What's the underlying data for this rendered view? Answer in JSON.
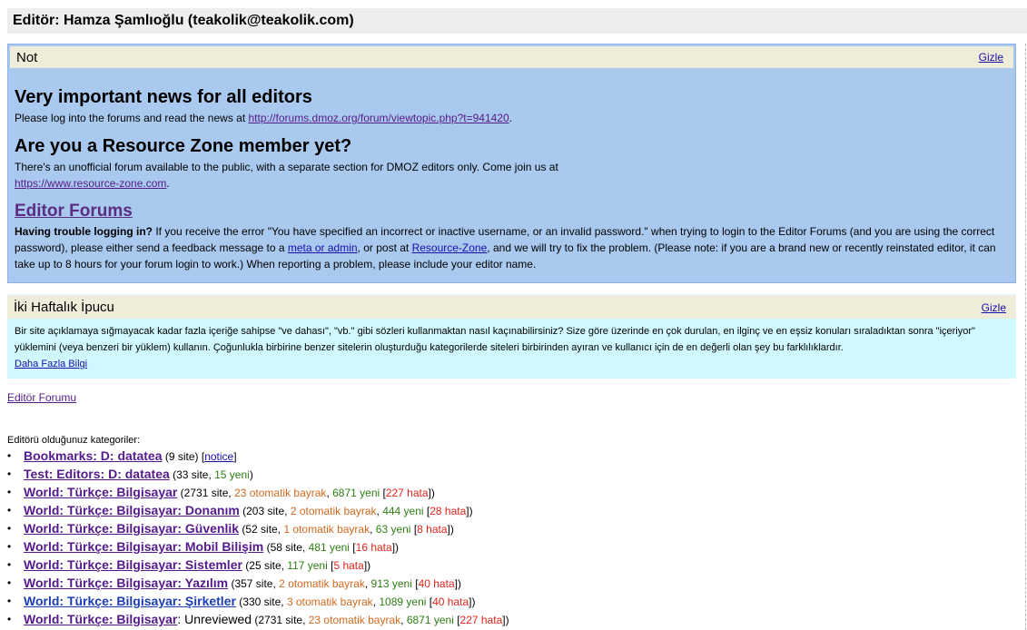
{
  "header": {
    "title": "Editör: Hamza Şamlıoğlu (teakolik@teakolik.com)"
  },
  "note_panel": {
    "label": "Not",
    "hide_label": "Gizle",
    "news_heading": "Very important news for all editors",
    "news_text": "Please log into the forums and read the news at ",
    "news_link": "http://forums.dmoz.org/forum/viewtopic.php?t=941420",
    "news_end": ".",
    "rz_heading": "Are you a Resource Zone member yet?",
    "rz_text": "There's an unofficial forum available to the public, with a separate section for DMOZ editors only. Come join us at",
    "rz_link": "https://www.resource-zone.com",
    "rz_end": ".",
    "forums_heading": "Editor Forums",
    "trouble_bold": "Having trouble logging in?",
    "trouble_text1": " If you receive the error \"You have specified an incorrect or inactive username, or an invalid password.\" when trying to login to the Editor Forums (and you are using the correct password), please either send a feedback message to a ",
    "meta_link": "meta or admin",
    "trouble_text2": ", or post at ",
    "rz_post_link": "Resource-Zone",
    "trouble_text3": ", and we will try to fix the problem. (Please note: if you are a brand new or recently reinstated editor, it can take up to 8 hours for your forum login to work.) When reporting a problem, please include your editor name."
  },
  "tip_panel": {
    "label": "İki Haftalık İpucu",
    "hide_label": "Gizle",
    "text": "Bir site açıklamaya sığmayacak kadar fazla içeriğe sahipse \"ve dahası\", \"vb.\" gibi sözleri kullanmaktan nasıl kaçınabilirsiniz? Size göre üzerinde en çok durulan, en ilginç ve en eşsiz konuları sıraladıktan sonra \"içeriyor\" yüklemini (veya benzeri bir yüklem) kullanın. Çoğunlukla birbirine benzer sitelerin oluşturduğu kategorilerde siteleri birbirinden ayıran ve kullanıcı için de en değerli olan şey bu farklılıklardır.",
    "more_link": "Daha Fazla Bilgi"
  },
  "forum_link": "Editör Forumu",
  "categories_heading": "Editörü olduğunuz kategoriler:",
  "categories": [
    {
      "name": "Bookmarks: D: datatea",
      "pre": " (9 site) [",
      "notice": "notice",
      "post": "]"
    },
    {
      "name": "Test: Editors: D: datatea",
      "pre": " (33 site, ",
      "new": "15 yeni",
      "post": ")"
    },
    {
      "name": "World: Türkçe: Bilgisayar",
      "pre": " (2731 site, ",
      "flags": "23 otomatik bayrak",
      "sep1": ", ",
      "new": "6871 yeni",
      "sep2": " [",
      "errors": "227 hata",
      "post": "])"
    },
    {
      "name": "World: Türkçe: Bilgisayar: Donanım",
      "pre": " (203 site, ",
      "flags": "2 otomatik bayrak",
      "sep1": ", ",
      "new": "444 yeni",
      "sep2": " [",
      "errors": "28 hata",
      "post": "])"
    },
    {
      "name": "World: Türkçe: Bilgisayar: Güvenlik",
      "pre": " (52 site, ",
      "flags": "1 otomatik bayrak",
      "sep1": ", ",
      "new": "63 yeni",
      "sep2": " [",
      "errors": "8 hata",
      "post": "])"
    },
    {
      "name": "World: Türkçe: Bilgisayar: Mobil Bilişim",
      "pre": " (58 site, ",
      "new": "481 yeni",
      "sep2": " [",
      "errors": "16 hata",
      "post": "])"
    },
    {
      "name": "World: Türkçe: Bilgisayar: Sistemler",
      "pre": " (25 site, ",
      "new": "117 yeni",
      "sep2": " [",
      "errors": "5 hata",
      "post": "])"
    },
    {
      "name": "World: Türkçe: Bilgisayar: Yazılım",
      "pre": " (357 site, ",
      "flags": "2 otomatik bayrak",
      "sep1": ", ",
      "new": "913 yeni",
      "sep2": " [",
      "errors": "40 hata",
      "post": "])"
    },
    {
      "name": "World: Türkçe: Bilgisayar: Şirketler",
      "pre": " (330 site, ",
      "flags": "3 otomatik bayrak",
      "sep1": ", ",
      "new": "1089 yeni",
      "sep2": " [",
      "errors": "40 hata",
      "post": "])"
    },
    {
      "name": "World: Türkçe: Bilgisayar",
      "suffix": ": Unreviewed",
      "pre": " (2731 site, ",
      "flags": "23 otomatik bayrak",
      "sep1": ", ",
      "new": "6871 yeni",
      "sep2": " [",
      "errors": "227 hata",
      "post": "])"
    }
  ],
  "colors": {
    "note_bg": "#a9c9ee",
    "tip_bg": "#d0f8ff",
    "title_bar_bg": "#efecda",
    "flags": "#d2691e",
    "new": "#2e7d15",
    "errors": "#e0261c"
  }
}
